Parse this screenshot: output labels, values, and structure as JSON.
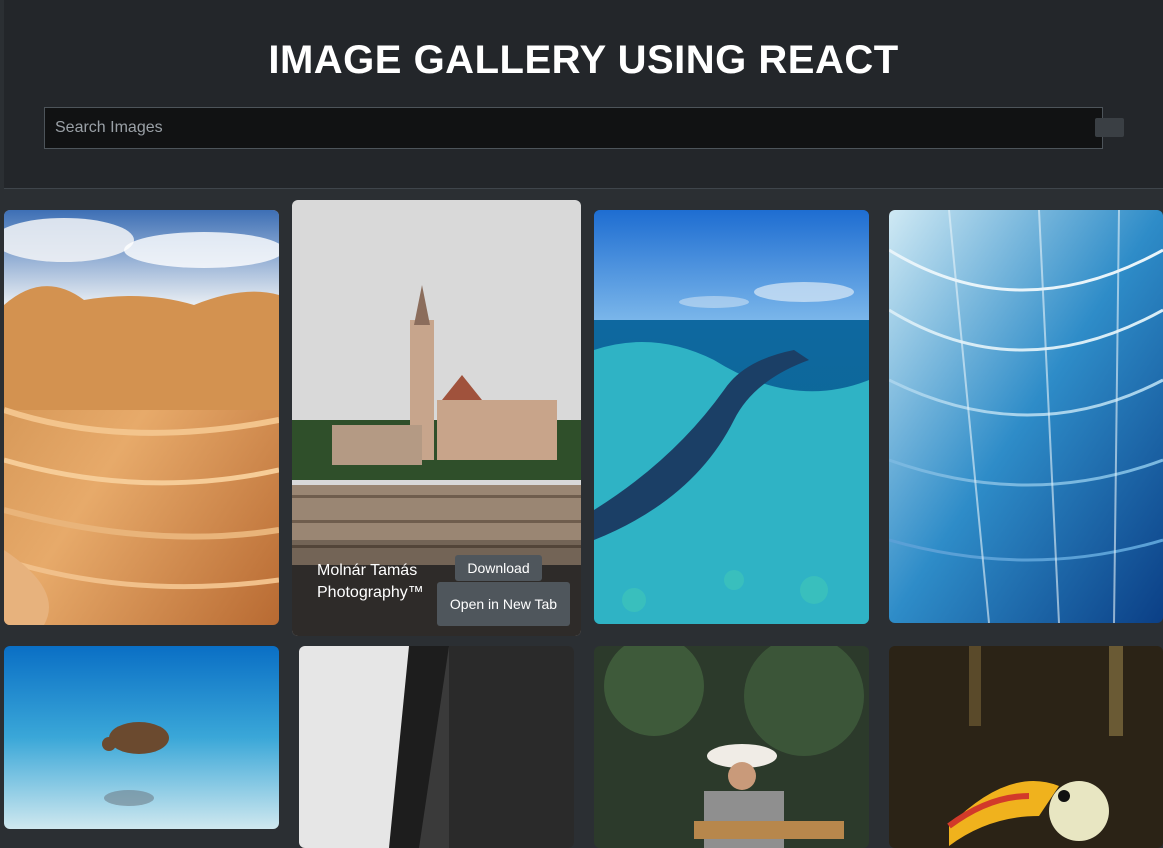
{
  "app": {
    "title": "IMAGE GALLERY USING REACT",
    "search": {
      "placeholder": "Search Images",
      "value": ""
    }
  },
  "gallery": {
    "hovered_card": {
      "author": "Molnár Tamás Photography™",
      "download_label": "Download",
      "open_label": "Open in New Tab"
    }
  },
  "colors": {
    "page_bg": "#2b2f33",
    "header_bg": "#23262a",
    "button_bg": "#4f565c"
  }
}
